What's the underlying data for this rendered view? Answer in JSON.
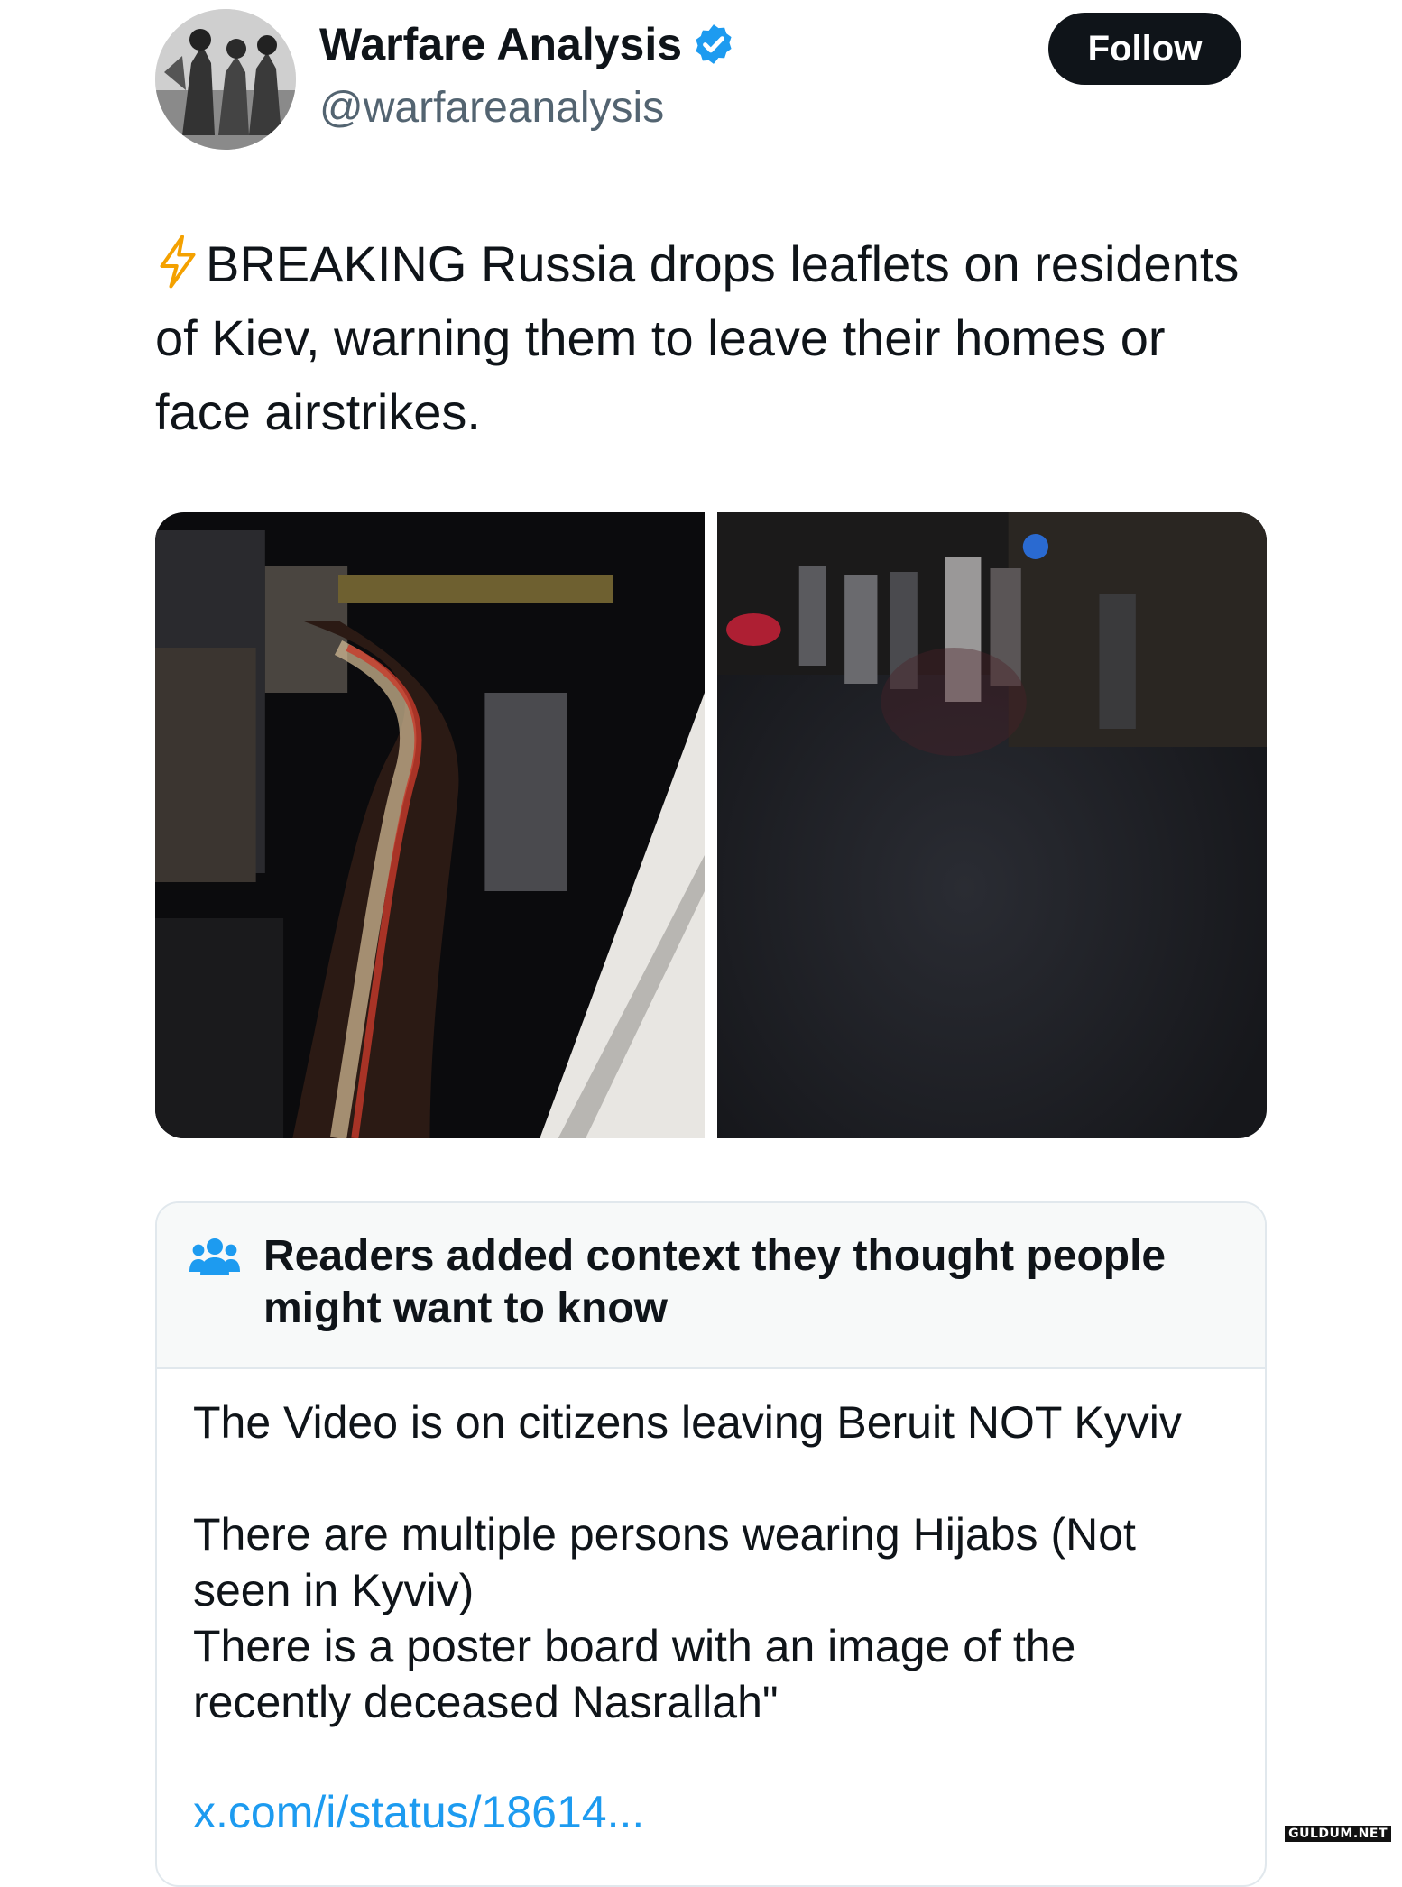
{
  "profile": {
    "display_name": "Warfare Analysis",
    "handle": "@warfareanalysis",
    "verified": true,
    "avatar_icon": "avatar-photo-soldiers"
  },
  "follow_label": "Follow",
  "tweet": {
    "emoji_icon": "high-voltage-icon",
    "text": "BREAKING Russia drops leaflets on residents of Kiev, warning them to leave their homes or face airstrikes."
  },
  "media": {
    "count": 2
  },
  "community_note": {
    "title": "Readers added context they thought people might want to know",
    "line1": "The Video is on citizens leaving Beruit NOT Kyviv",
    "line2": "There are multiple persons wearing Hijabs (Not seen in Kyviv)",
    "line3": "There is a poster board with an image of the recently deceased Nasrallah\"",
    "link": "x.com/i/status/18614..."
  },
  "watermark": "GULDUM.NET",
  "colors": {
    "link": "#1d9bf0",
    "verified": "#1d9bf0",
    "follow_bg": "#0f1419"
  }
}
